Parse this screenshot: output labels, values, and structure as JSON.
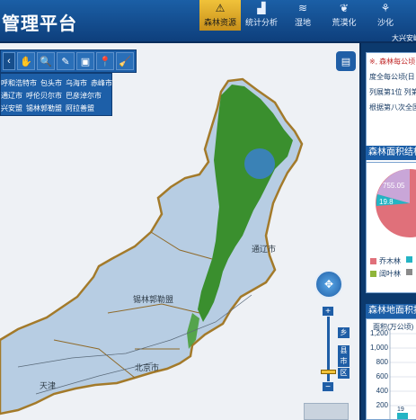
{
  "app": {
    "title": "管理平台",
    "logged_in_text": "大兴安岭"
  },
  "nav": [
    {
      "label": "森林资源",
      "icon": "warning-triangle-icon",
      "glyph": "⚠",
      "active": true
    },
    {
      "label": "统计分析",
      "icon": "stats-chart-icon",
      "glyph": "▟",
      "active": false
    },
    {
      "label": "湿地",
      "icon": "wetland-icon",
      "glyph": "≋",
      "active": false
    },
    {
      "label": "荒漠化",
      "icon": "desert-icon",
      "glyph": "❦",
      "active": false
    },
    {
      "label": "沙化",
      "icon": "sand-icon",
      "glyph": "⚘",
      "active": false
    }
  ],
  "toolbar": {
    "tools": [
      {
        "name": "pan-hand-icon",
        "glyph": "✋"
      },
      {
        "name": "zoom-search-icon",
        "glyph": "🔍"
      },
      {
        "name": "measure-ruler-icon",
        "glyph": "✎"
      },
      {
        "name": "frame-select-icon",
        "glyph": "▣"
      },
      {
        "name": "location-pin-icon",
        "glyph": "📍"
      },
      {
        "name": "clear-broom-icon",
        "glyph": "🧹"
      }
    ]
  },
  "cities": [
    [
      "呼和浩特市",
      "包头市",
      "乌海市",
      "赤峰市"
    ],
    [
      "通辽市",
      "呼伦贝尔市",
      "巴彦淖尔市"
    ],
    [
      "兴安盟",
      "锡林郭勒盟",
      "阿拉善盟"
    ]
  ],
  "map": {
    "labels": [
      "通辽市",
      "锡林郭勒盟",
      "北京市",
      "天津"
    ],
    "zoom_levels": [
      "乡",
      "县",
      "市",
      "区"
    ],
    "zoom_in": "+",
    "zoom_out": "−"
  },
  "right_panel": {
    "info_lines": [
      "※, 森林每公顷",
      "度全每公顷(日",
      "列展第1位 列第",
      "根据第八次全国"
    ],
    "forest_area_title": "森林面积结构",
    "pie_values": [
      "755.05",
      "19.8"
    ],
    "legend": [
      {
        "label": "乔木林",
        "color": "#e0707a"
      },
      {
        "label": "",
        "color": "#24b4c4"
      },
      {
        "label": "阔叶林",
        "color": "#8fb53a"
      },
      {
        "label": "",
        "color": "#8a8a8a"
      }
    ],
    "landarea_title": "森林地面积按",
    "unit": "面积(万公顷)",
    "yticks": [
      "1,200",
      "1,000",
      "800",
      "600",
      "400",
      "200"
    ],
    "bar_value_hint": "19"
  },
  "colors": {
    "header": "#1b5fa6",
    "active_tab": "#f0c23a",
    "forest": "#2f8a1e",
    "region": "#b9cfe4"
  }
}
